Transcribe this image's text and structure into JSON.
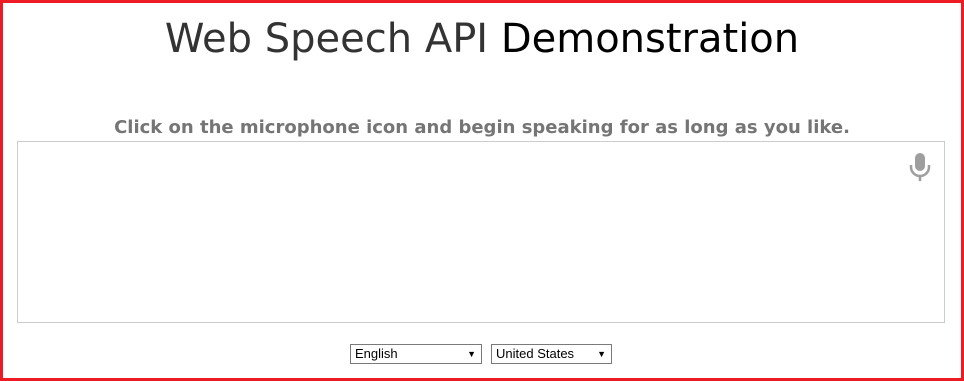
{
  "header": {
    "title_part1": "Web Speech API ",
    "title_part2": "Demonstration"
  },
  "info": {
    "text": "Click on the microphone icon and begin speaking for as long as you like."
  },
  "results": {
    "text": ""
  },
  "mic": {
    "icon": "microphone-icon",
    "color": "#9e9e9e"
  },
  "language_select": {
    "value": "English",
    "arrow": "▼"
  },
  "dialect_select": {
    "value": "United States",
    "arrow": "▼"
  },
  "colors": {
    "frame_border": "#ed1c24",
    "title": "#333333",
    "info": "#757575"
  }
}
